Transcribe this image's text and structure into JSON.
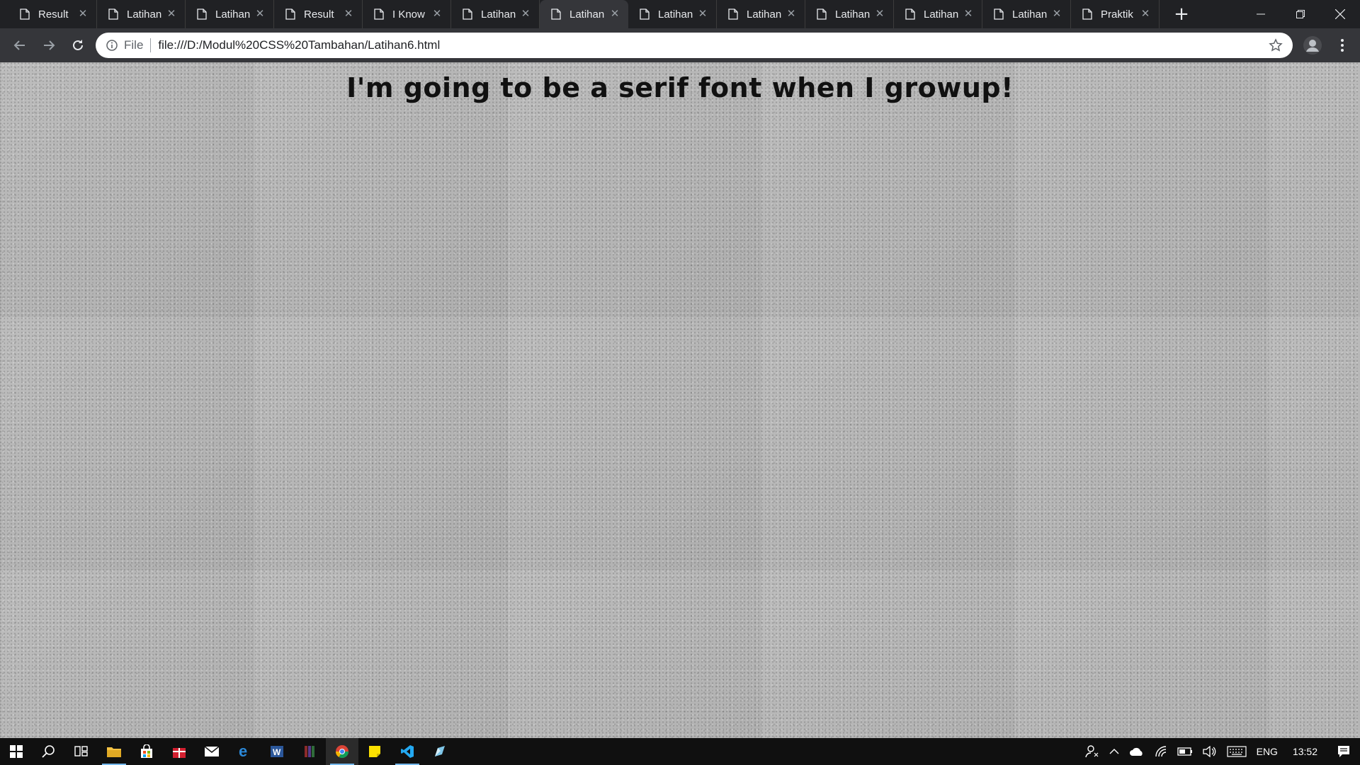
{
  "browser": {
    "tabs": [
      {
        "title": "Result",
        "active": false
      },
      {
        "title": "Latihan",
        "active": false
      },
      {
        "title": "Latihan",
        "active": false
      },
      {
        "title": "Result",
        "active": false
      },
      {
        "title": "I Know",
        "active": false
      },
      {
        "title": "Latihan",
        "active": false
      },
      {
        "title": "Latihan",
        "active": true
      },
      {
        "title": "Latihan",
        "active": false
      },
      {
        "title": "Latihan",
        "active": false
      },
      {
        "title": "Latihan",
        "active": false
      },
      {
        "title": "Latihan",
        "active": false
      },
      {
        "title": "Latihan",
        "active": false
      },
      {
        "title": "Praktik",
        "active": false
      }
    ],
    "new_tab_icon": "plus-icon",
    "address": {
      "scheme_label": "File",
      "url": "file:///D:/Modul%20CSS%20Tambahan/Latihan6.html"
    }
  },
  "page": {
    "heading": "I'm going to be a serif font when I growup!"
  },
  "taskbar": {
    "language": "ENG",
    "time": "13:52"
  },
  "colors": {
    "tabstrip_bg": "#202124",
    "toolbar_bg": "#35363a",
    "page_bg": "#b9b9b9",
    "taskbar_bg": "#101010"
  }
}
